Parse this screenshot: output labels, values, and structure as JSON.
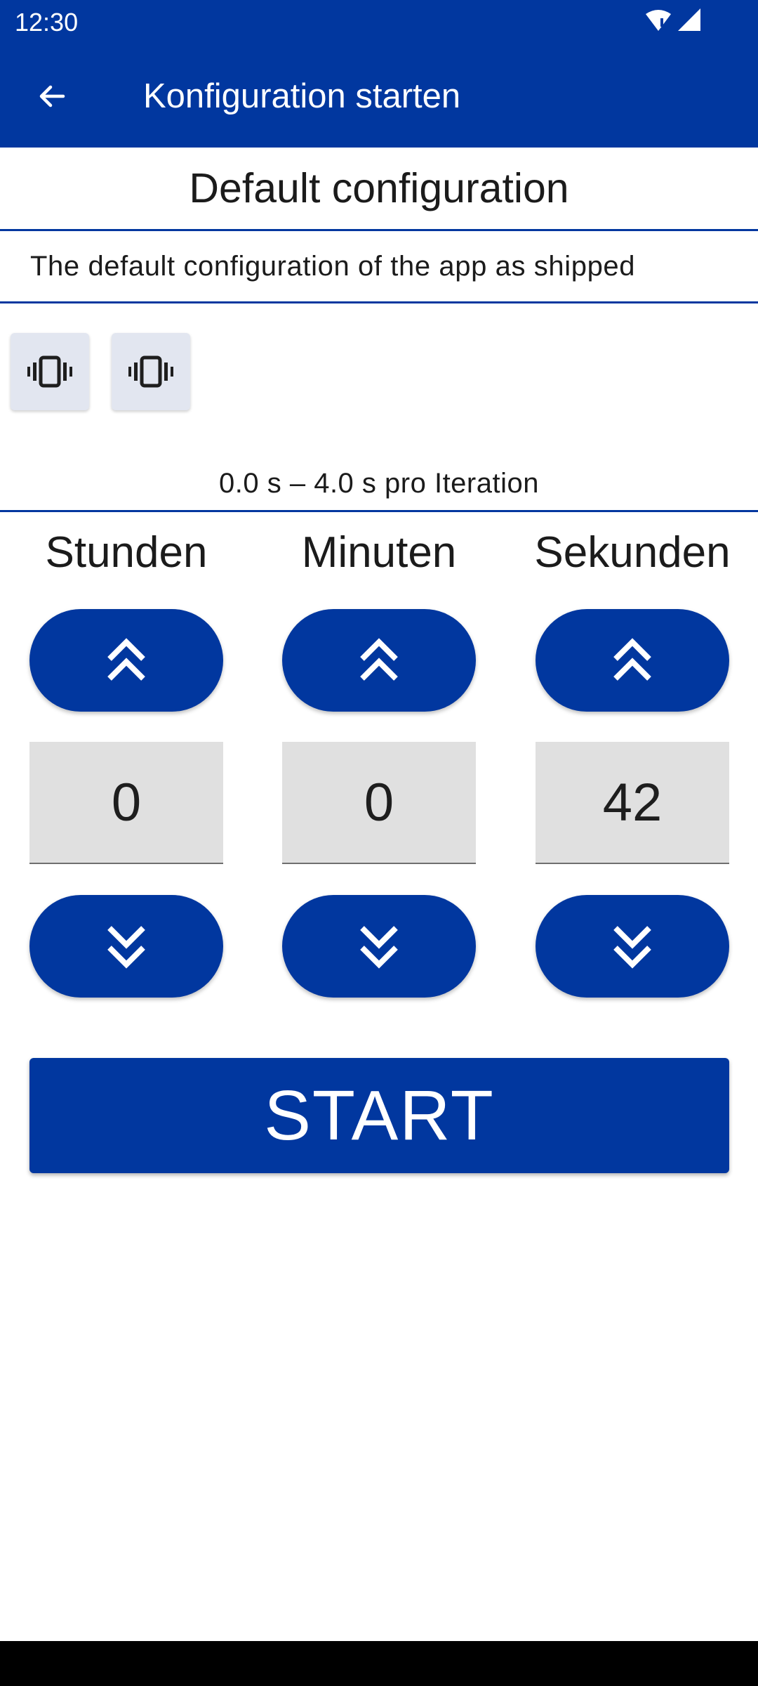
{
  "status_bar": {
    "time": "12:30",
    "icons": [
      "wifi-icon",
      "signal-icon"
    ]
  },
  "app_bar": {
    "title": "Konfiguration starten",
    "back_icon": "arrow-back-icon"
  },
  "config": {
    "title": "Default configuration",
    "description": "The default configuration of the app as shipped"
  },
  "vibration_buttons": [
    {
      "icon": "vibration-icon"
    },
    {
      "icon": "vibration-icon"
    }
  ],
  "iteration_text": "0.0 s – 4.0 s pro Iteration",
  "timer": {
    "columns": [
      {
        "label": "Stunden",
        "value": "0"
      },
      {
        "label": "Minuten",
        "value": "0"
      },
      {
        "label": "Sekunden",
        "value": "42"
      }
    ],
    "increase_icon": "double-chevron-up-icon",
    "decrease_icon": "double-chevron-down-icon"
  },
  "start_button": "START",
  "colors": {
    "primary": "#01379f",
    "value_box": "#e0e0e0",
    "vibration_button": "#e2e6f0"
  }
}
